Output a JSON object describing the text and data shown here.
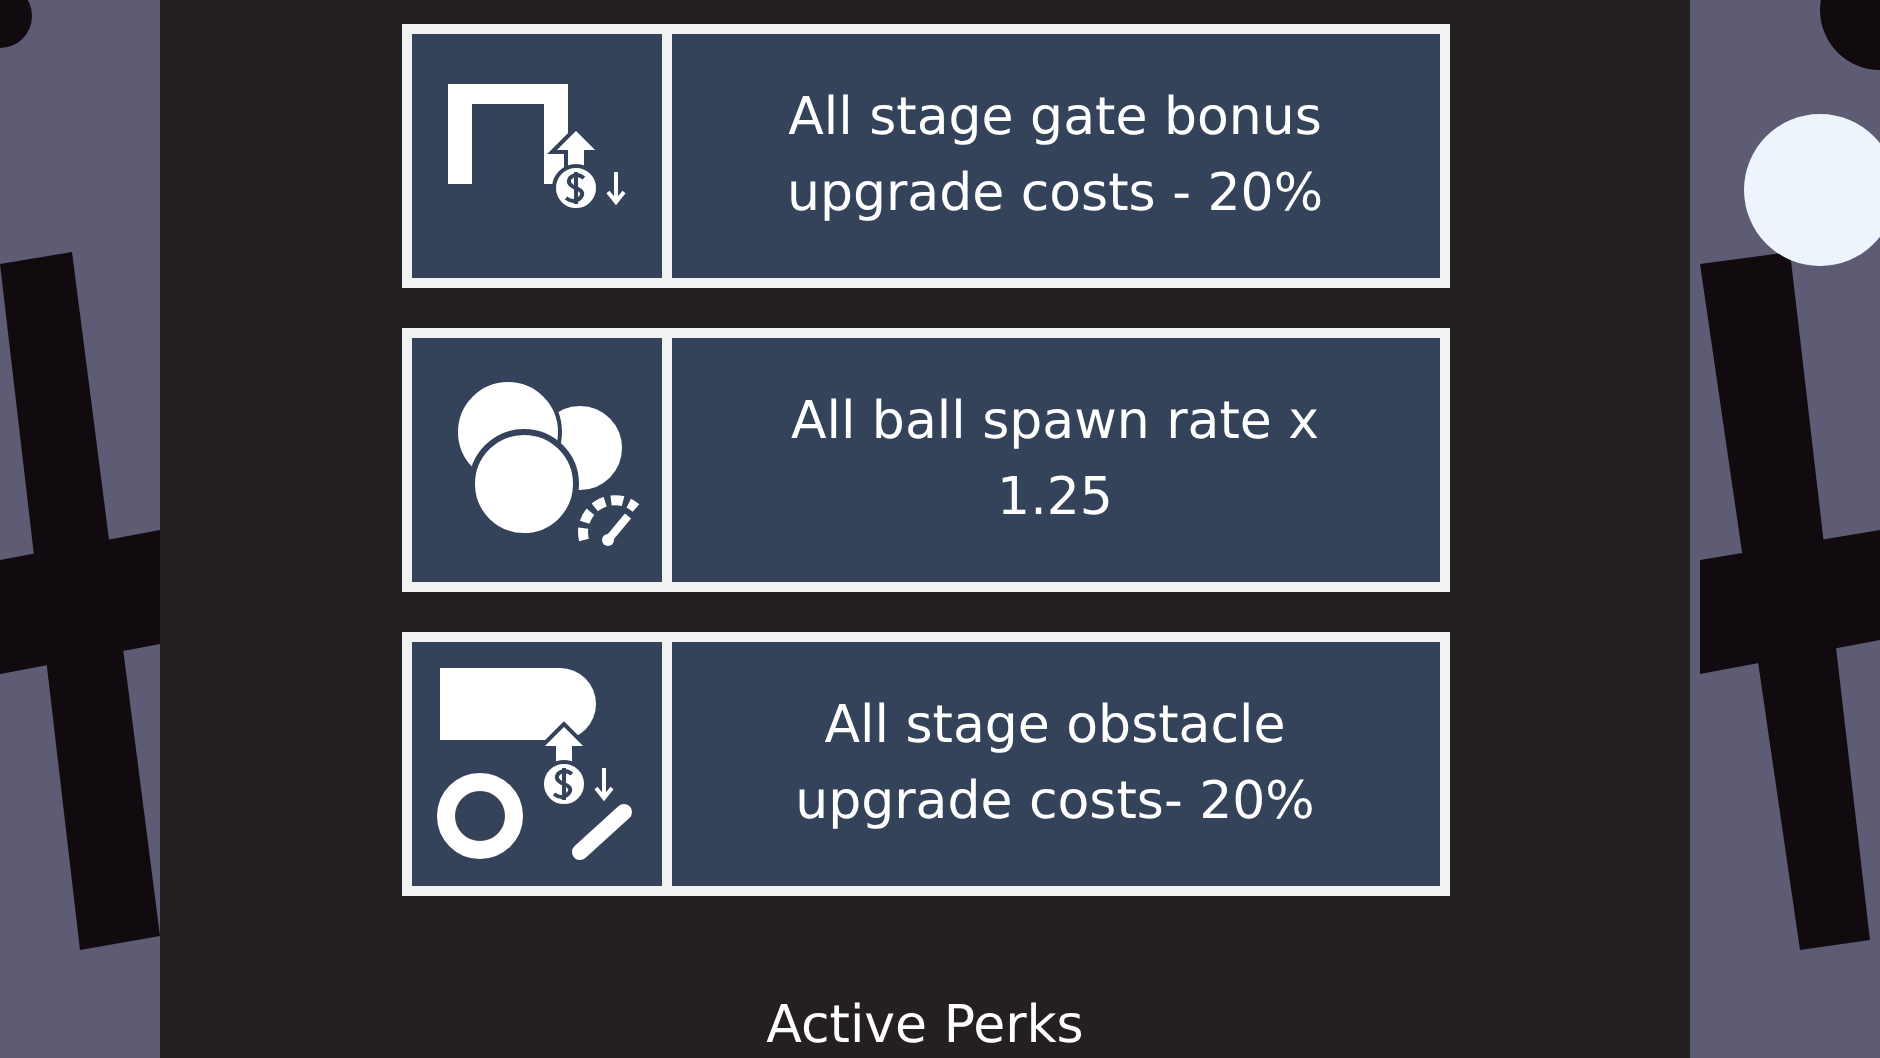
{
  "perks": [
    {
      "kind": "gate",
      "text": "All stage gate bonus upgrade costs - 20%"
    },
    {
      "kind": "balls",
      "text": "All ball spawn rate x 1.25"
    },
    {
      "kind": "obstacle",
      "text": "All stage obstacle upgrade costs- 20%"
    }
  ],
  "section_title": "Active Perks"
}
